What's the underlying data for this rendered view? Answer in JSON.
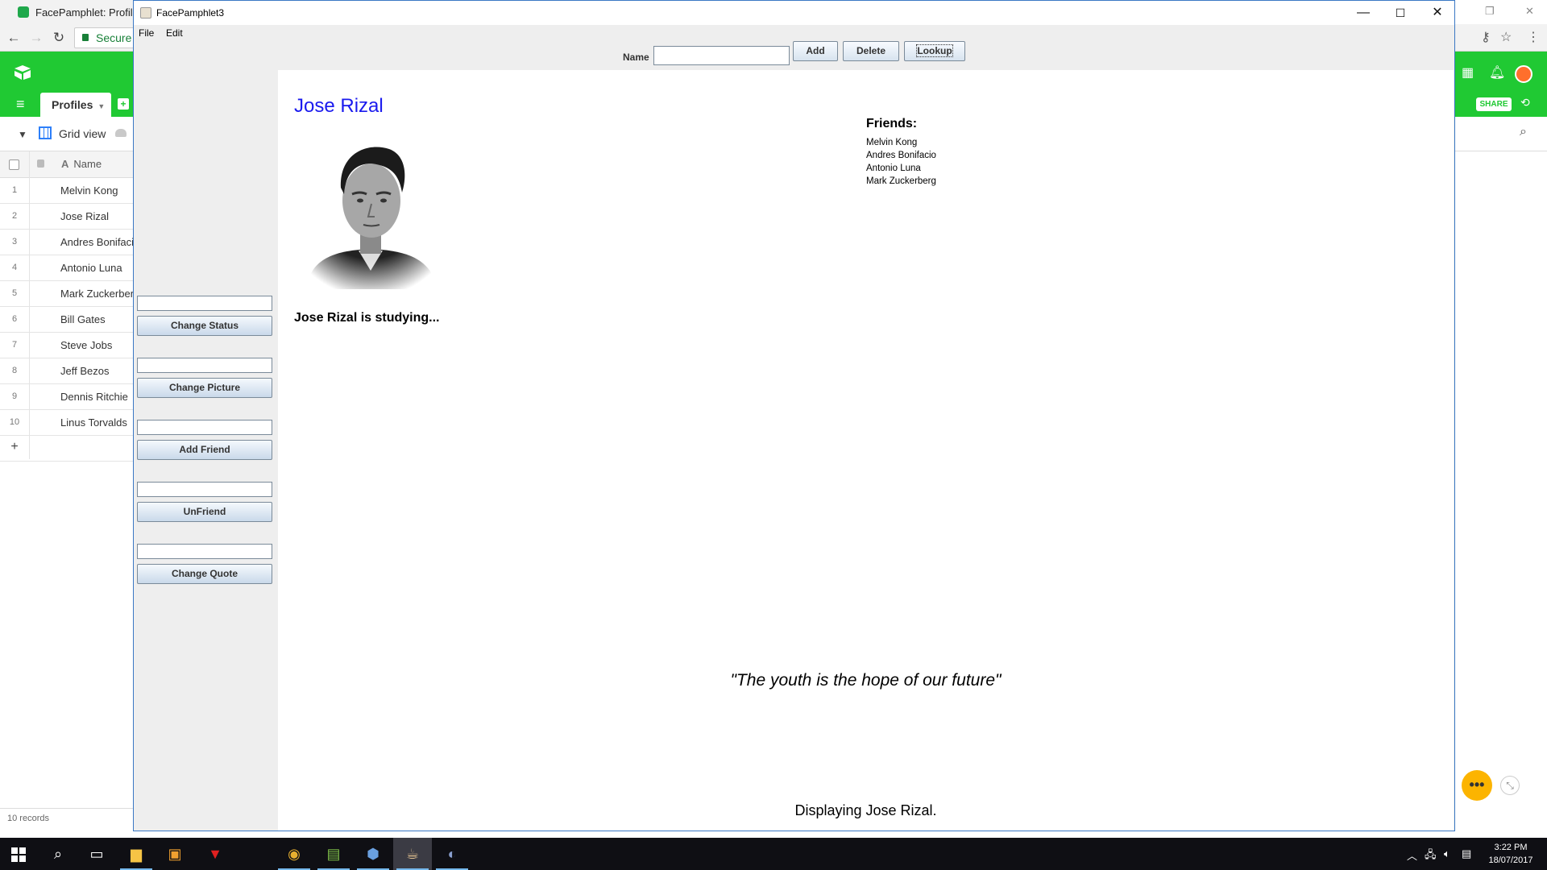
{
  "browser": {
    "tab_title": "FacePamphlet: Profiles",
    "url_secure_label": "Secure"
  },
  "airtable": {
    "table_tab": "Profiles",
    "view_name": "Grid view",
    "column_name": "Name",
    "rows": [
      {
        "num": "1",
        "name": "Melvin Kong"
      },
      {
        "num": "2",
        "name": "Jose Rizal"
      },
      {
        "num": "3",
        "name": "Andres Bonifacio"
      },
      {
        "num": "4",
        "name": "Antonio Luna"
      },
      {
        "num": "5",
        "name": "Mark Zuckerberg"
      },
      {
        "num": "6",
        "name": "Bill Gates"
      },
      {
        "num": "7",
        "name": "Steve Jobs"
      },
      {
        "num": "8",
        "name": "Jeff Bezos"
      },
      {
        "num": "9",
        "name": "Dennis Ritchie"
      },
      {
        "num": "10",
        "name": "Linus Torvalds"
      }
    ],
    "add_row": "+",
    "record_count": "10 records",
    "share_label": "SHARE"
  },
  "app": {
    "window_title": "FacePamphlet3",
    "menu": [
      "File",
      "Edit"
    ],
    "top": {
      "name_label": "Name",
      "name_value": "",
      "add_label": "Add",
      "delete_label": "Delete",
      "lookup_label": "Lookup"
    },
    "side": {
      "change_status": "Change Status",
      "change_picture": "Change Picture",
      "add_friend": "Add Friend",
      "unfriend": "UnFriend",
      "change_quote": "Change Quote"
    },
    "profile": {
      "name": "Jose Rizal",
      "status": "Jose Rizal is studying...",
      "friends_title": "Friends:",
      "friends": [
        "Melvin Kong",
        "Andres Bonifacio",
        "Antonio Luna",
        "Mark Zuckerberg"
      ],
      "quote": "\"The youth is the hope of our future\""
    },
    "message": "Displaying Jose Rizal."
  },
  "taskbar": {
    "time": "3:22 PM",
    "date": "18/07/2017"
  },
  "colors": {
    "airtable_green": "#20c933",
    "profile_name_blue": "#1a1aee",
    "taskbar": "#0f0f14"
  }
}
